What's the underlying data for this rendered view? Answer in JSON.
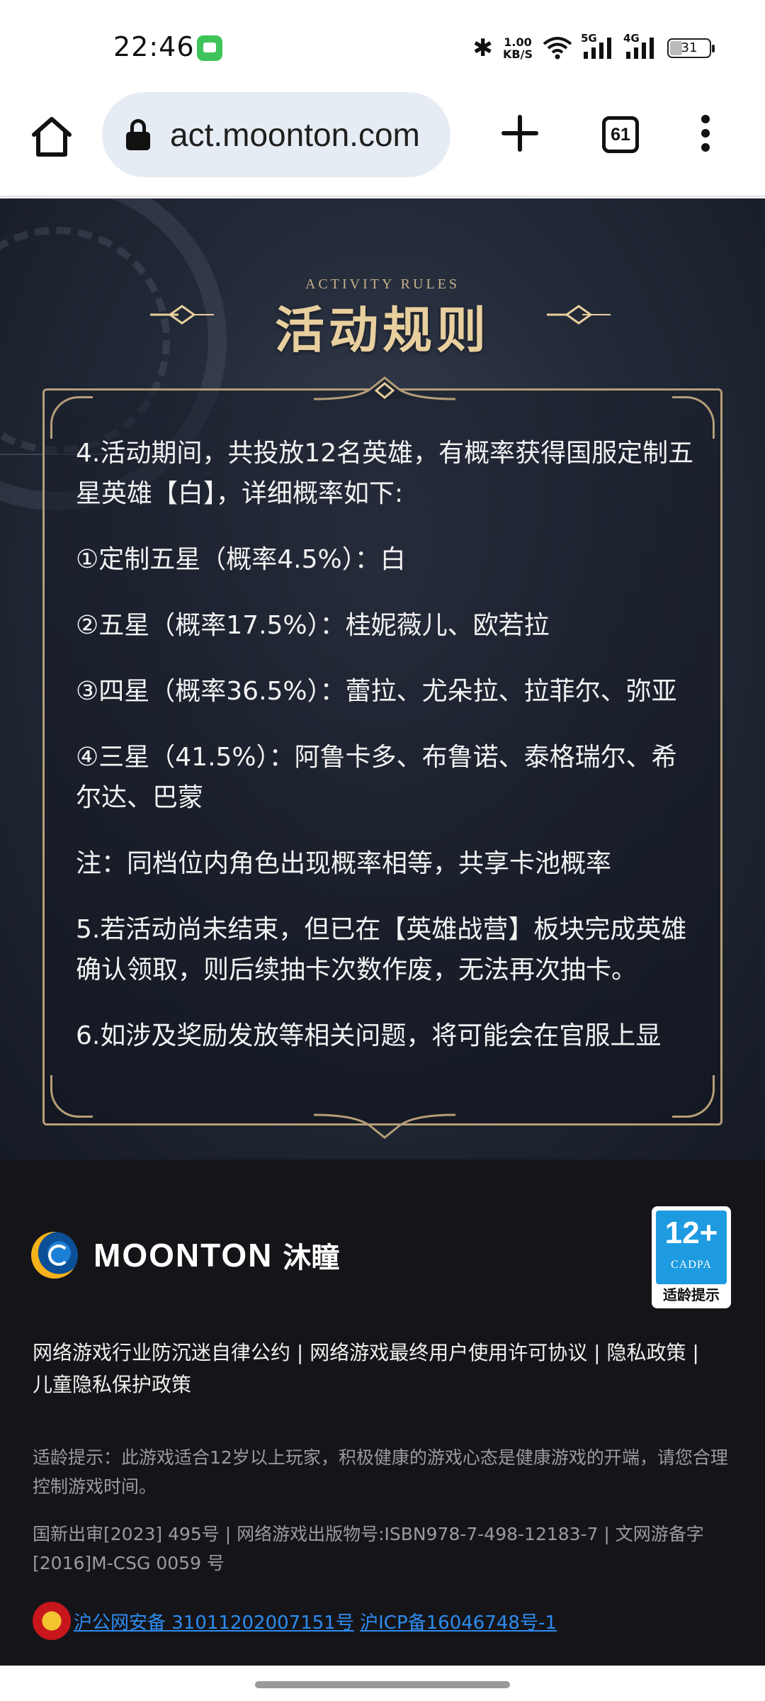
{
  "status_bar": {
    "time": "22:46",
    "net_speed_value": "1.00",
    "net_speed_unit": "KB/S",
    "signal1_label": "5G",
    "signal2_label": "4G",
    "battery": "31",
    "battery_level_percent": 31
  },
  "browser": {
    "url": "act.moonton.com",
    "tab_count": "61"
  },
  "rules": {
    "header_sub": "ACTIVITY RULES",
    "header_title": "活动规则",
    "paragraphs": [
      "4.活动期间，共投放12名英雄，有概率获得国服定制五星英雄【白】，详细概率如下:",
      "①定制五星（概率4.5%）：白",
      "②五星（概率17.5%）：桂妮薇儿、欧若拉",
      "③四星（概率36.5%）：蕾拉、尤朵拉、拉菲尔、弥亚",
      "④三星（41.5%）：阿鲁卡多、布鲁诺、泰格瑞尔、希尔达、巴蒙",
      "注：同档位内角色出现概率相等，共享卡池概率",
      "5.若活动尚未结束，但已在【英雄战营】板块完成英雄确认领取，则后续抽卡次数作废，无法再次抽卡。",
      "6.如涉及奖励发放等相关问题，将可能会在官服上显"
    ]
  },
  "footer": {
    "logo_text": "MOONTON",
    "logo_cn": "沐瞳",
    "age_badge_num": "12+",
    "age_badge_org": "CADPA",
    "age_badge_label": "适龄提示",
    "links": [
      "网络游戏行业防沉迷自律公约",
      "网络游戏最终用户使用许可协议",
      "隐私政策",
      "儿童隐私保护政策"
    ],
    "link_separator": " | ",
    "age_tip": "适龄提示：此游戏适合12岁以上玩家，积极健康的游戏心态是健康游戏的开端，请您合理控制游戏时间。",
    "registration": "国新出审[2023] 495号  |  网络游戏出版物号:ISBN978-7-498-12183-7  |  文网游备字[2016]M-CSG 0059 号",
    "beian_police": "沪公网安备 31011202007151号",
    "beian_icp": "沪ICP备16046748号-1"
  },
  "colors": {
    "gold": "#e8cf9e",
    "frame": "#b59e78",
    "link_blue": "#2d8cf0",
    "footer_bg": "#151519"
  }
}
